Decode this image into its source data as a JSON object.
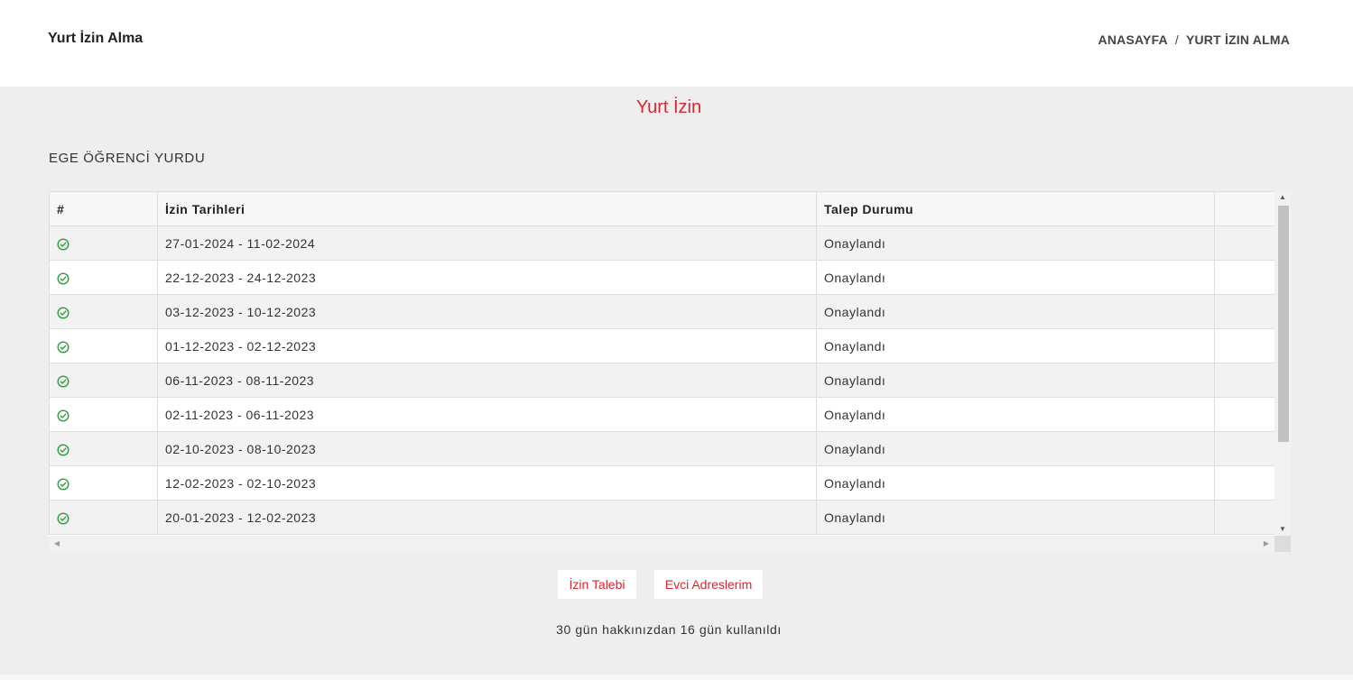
{
  "header": {
    "title": "Yurt İzin Alma",
    "breadcrumb": [
      "ANASAYFA",
      "YURT İZIN ALMA"
    ],
    "breadcrumb_separator": "/"
  },
  "main": {
    "section_title": "Yurt İzin",
    "dorm_name": "EGE ÖĞRENCİ YURDU",
    "table": {
      "columns": [
        "#",
        "İzin Tarihleri",
        "Talep Durumu",
        ""
      ],
      "rows": [
        {
          "icon": "check-circle-icon",
          "dates": "27-01-2024 - 11-02-2024",
          "status": "Onaylandı"
        },
        {
          "icon": "check-circle-icon",
          "dates": "22-12-2023 - 24-12-2023",
          "status": "Onaylandı"
        },
        {
          "icon": "check-circle-icon",
          "dates": "03-12-2023 - 10-12-2023",
          "status": "Onaylandı"
        },
        {
          "icon": "check-circle-icon",
          "dates": "01-12-2023 - 02-12-2023",
          "status": "Onaylandı"
        },
        {
          "icon": "check-circle-icon",
          "dates": "06-11-2023 - 08-11-2023",
          "status": "Onaylandı"
        },
        {
          "icon": "check-circle-icon",
          "dates": "02-11-2023 - 06-11-2023",
          "status": "Onaylandı"
        },
        {
          "icon": "check-circle-icon",
          "dates": "02-10-2023 - 08-10-2023",
          "status": "Onaylandı"
        },
        {
          "icon": "check-circle-icon",
          "dates": "12-02-2023 - 02-10-2023",
          "status": "Onaylandı"
        },
        {
          "icon": "check-circle-icon",
          "dates": "20-01-2023 - 12-02-2023",
          "status": "Onaylandı"
        }
      ]
    },
    "buttons": {
      "request": "İzin Talebi",
      "addresses": "Evci Adreslerim"
    },
    "usage_text": "30 gün hakkınızdan 16 gün kullanıldı"
  },
  "colors": {
    "accent": "#d9252f",
    "check_green": "#2e9e3f",
    "main_background": "#eeeeee"
  }
}
